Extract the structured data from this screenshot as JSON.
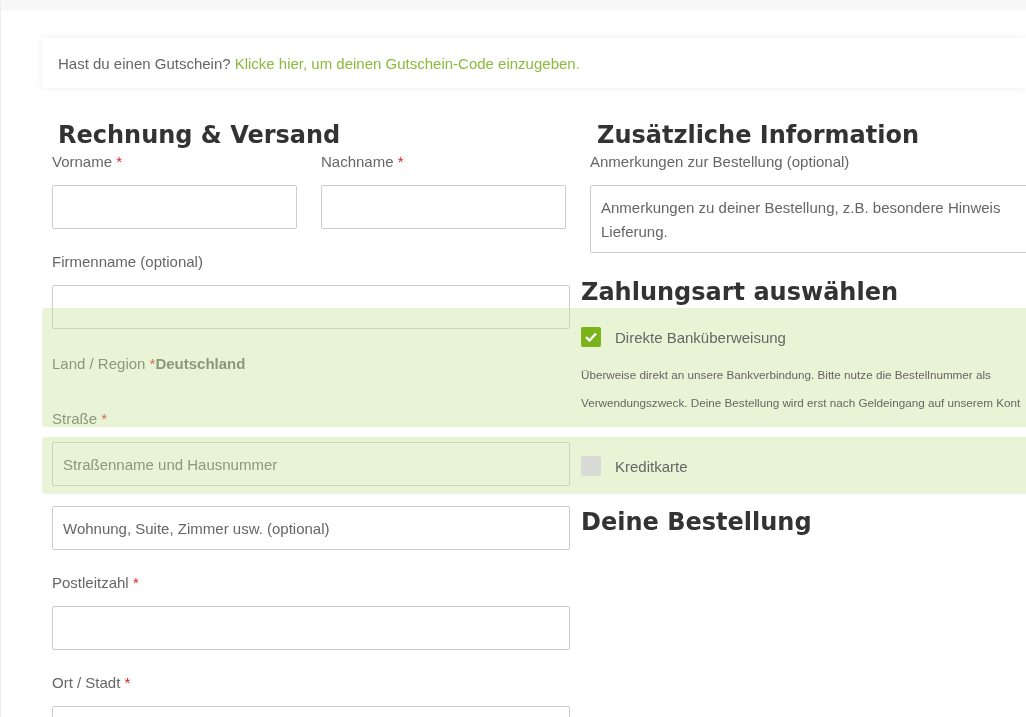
{
  "coupon": {
    "text": "Hast du einen Gutschein?",
    "link": "Klicke hier, um deinen Gutschein-Code einzugeben."
  },
  "billing": {
    "title": "Rechnung & Versand",
    "fields": [
      {
        "kind": "half",
        "label": "Vorname",
        "mark": "*"
      },
      {
        "kind": "half",
        "label": "Nachname",
        "mark": "*"
      },
      {
        "kind": "full",
        "label": "Firmenname (optional)"
      },
      {
        "kind": "static",
        "label": "Land / Region",
        "mark": "*",
        "value": "Deutschland"
      },
      {
        "kind": "full",
        "label": "Straße",
        "mark": "*",
        "placeholder": "Straßenname und Hausnummer"
      },
      {
        "kind": "bare",
        "placeholder": "Wohnung, Suite, Zimmer usw. (optional)"
      },
      {
        "kind": "full",
        "label": "Postleitzahl",
        "mark": "*"
      },
      {
        "kind": "full",
        "label": "Ort / Stadt",
        "mark": "*"
      }
    ]
  },
  "additional": {
    "title": "Zusätzliche Information",
    "notes_label": "Anmerkungen zur Bestellung (optional)",
    "notes_placeholder": "Anmerkungen zu deiner Bestellung, z.B. besondere Hinweis\nLieferung."
  },
  "payment": {
    "title": "Zahlungsart auswählen",
    "methods": [
      {
        "label": "Direkte Banküberweisung",
        "selected": true,
        "description_lines": [
          "Überweise direkt an unsere Bankverbindung. Bitte nutze die Bestellnummer als",
          "Verwendungszweck. Deine Bestellung wird erst nach Geldeingang auf unserem Kont"
        ]
      },
      {
        "label": "Kreditkarte",
        "selected": false
      }
    ]
  },
  "order": {
    "title": "Deine Bestellung"
  }
}
